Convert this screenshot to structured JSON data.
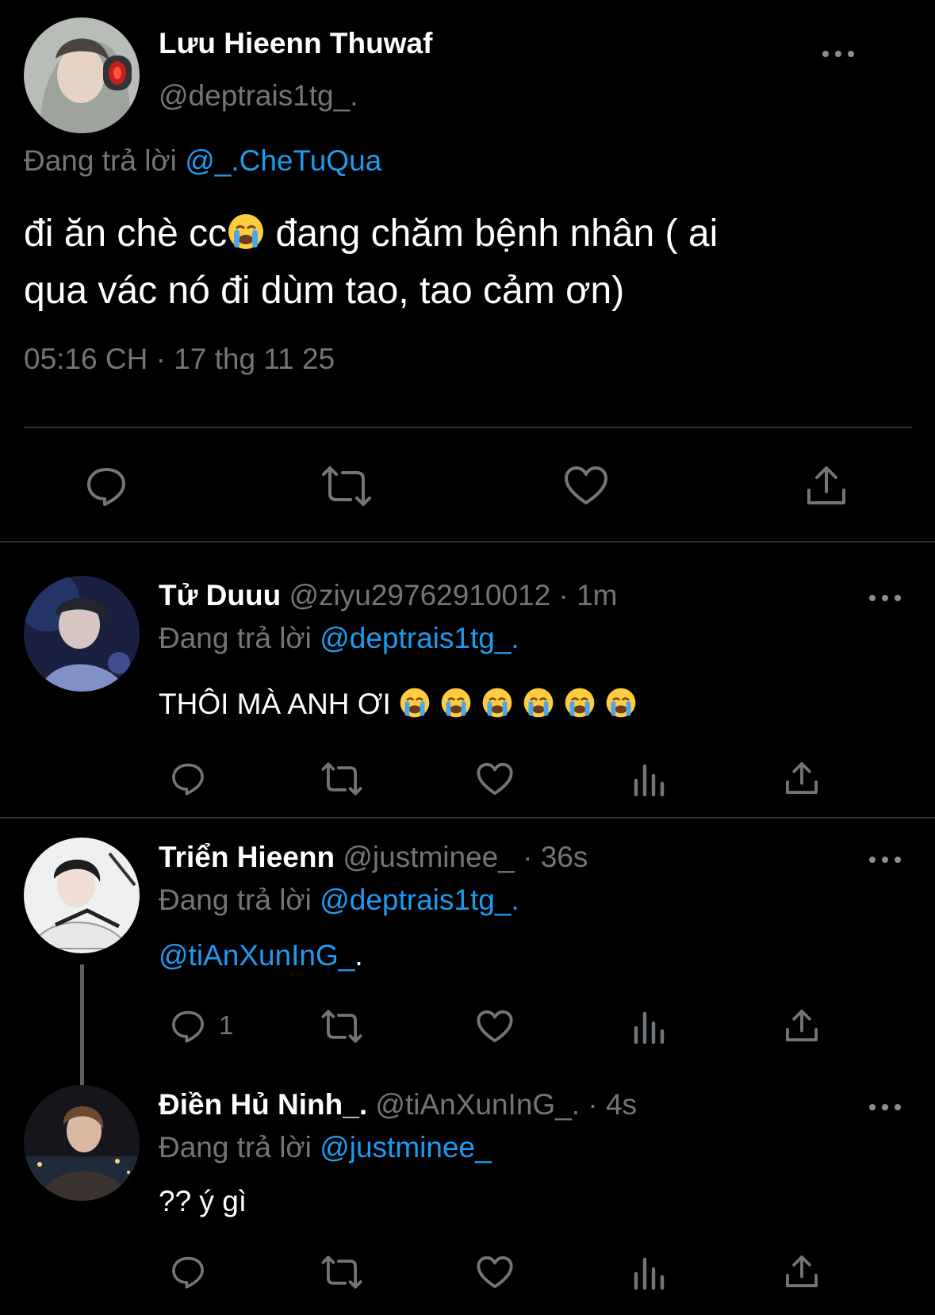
{
  "main_tweet": {
    "display_name": "Lưu Hieenn Thuwaf",
    "handle": "@deptrais1tg_.",
    "reply_prefix": "Đang trả lời",
    "reply_to": "@_.CheTuQua",
    "text_part1": "đi ăn chè cc",
    "text_part2": " đang chăm bệnh nhân ( ai",
    "text_line2": "qua vác nó đi dùm tao, tao cảm ơn)",
    "timestamp": "05:16 CH · 17 thg 11 25"
  },
  "replies": [
    {
      "display_name": "Tử Duuu",
      "handle": "@ziyu29762910012",
      "time": "· 1m",
      "reply_prefix": "Đang trả lời",
      "reply_to": "@deptrais1tg_.",
      "text": "THÔI MÀ ANH ƠI",
      "emoji_count": "6"
    },
    {
      "display_name": "Triển Hieenn",
      "handle": "@justminee_",
      "time": "· 36s",
      "reply_prefix": "Đang trả lời",
      "reply_to": "@deptrais1tg_.",
      "mention": "@tiAnXunInG_",
      "text_suffix": ".",
      "reply_count": "1"
    },
    {
      "display_name": "Điền Hủ Ninh_.",
      "handle": "@tiAnXunInG_.",
      "time": "· 4s",
      "reply_prefix": "Đang trả lời",
      "reply_to": "@justminee_",
      "text": "?? ý gì"
    }
  ],
  "icons": {
    "reply": "speech-bubble-icon",
    "retweet": "retweet-arrows-icon",
    "like": "heart-icon",
    "views": "bar-chart-icon",
    "share": "share-upload-icon",
    "more": "three-dots-icon",
    "crying_emoji": "loudly-crying-face-emoji"
  },
  "colors": {
    "background": "#000000",
    "text": "#e7e9ea",
    "muted": "#71767b",
    "link": "#1d9bf0"
  }
}
